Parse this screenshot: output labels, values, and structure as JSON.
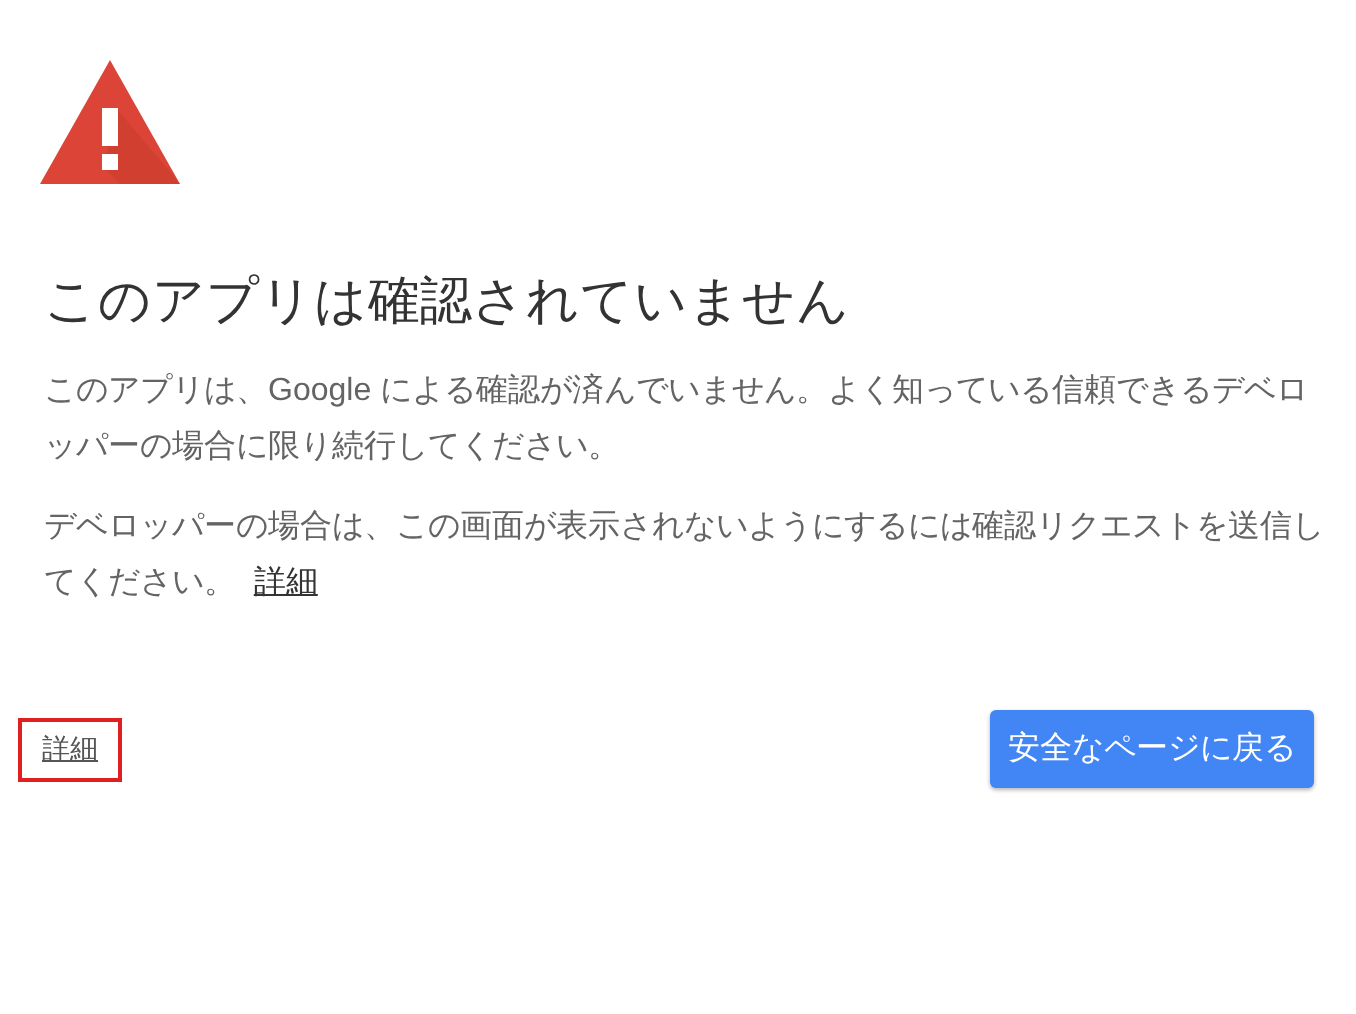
{
  "title": "このアプリは確認されていません",
  "paragraphs": [
    {
      "text": "このアプリは、Google による確認が済んでいません。よく知っている信頼できるデベロッパーの場合に限り続行してください。"
    },
    {
      "text": "デベロッパーの場合は、この画面が表示されないようにするには確認リクエストを送信してください。",
      "link": "詳細"
    }
  ],
  "details_link": {
    "label": "詳細",
    "highlighted": true
  },
  "back_button": {
    "label": "安全なページに戻る"
  }
}
